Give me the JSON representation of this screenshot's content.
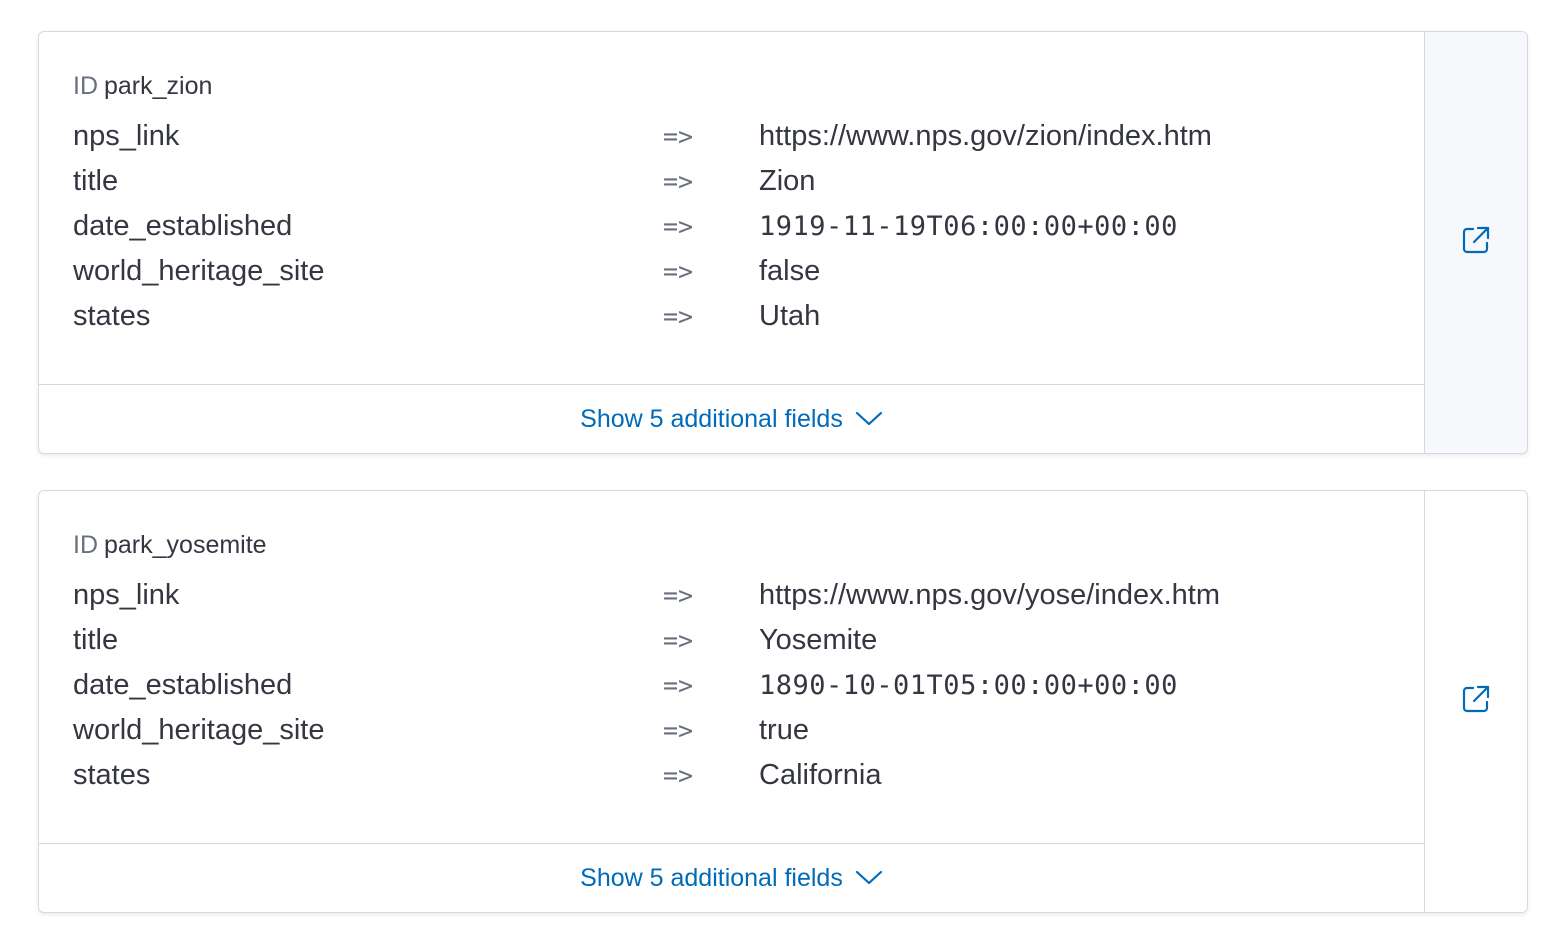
{
  "results": [
    {
      "id_label": "ID",
      "id_value": "park_zion",
      "fields": [
        {
          "key": "nps_link",
          "arrow": "=>",
          "value": "https://www.nps.gov/zion/index.htm"
        },
        {
          "key": "title",
          "arrow": "=>",
          "value": "Zion"
        },
        {
          "key": "date_established",
          "arrow": "=>",
          "value": "1919-11-19T06:00:00+00:00"
        },
        {
          "key": "world_heritage_site",
          "arrow": "=>",
          "value": "false"
        },
        {
          "key": "states",
          "arrow": "=>",
          "value": "Utah"
        }
      ],
      "show_more_label": "Show 5 additional fields",
      "chevron_icon": "chevron-down-icon",
      "link_icon": "external-link-icon"
    },
    {
      "id_label": "ID",
      "id_value": "park_yosemite",
      "fields": [
        {
          "key": "nps_link",
          "arrow": "=>",
          "value": "https://www.nps.gov/yose/index.htm"
        },
        {
          "key": "title",
          "arrow": "=>",
          "value": "Yosemite"
        },
        {
          "key": "date_established",
          "arrow": "=>",
          "value": "1890-10-01T05:00:00+00:00"
        },
        {
          "key": "world_heritage_site",
          "arrow": "=>",
          "value": "true"
        },
        {
          "key": "states",
          "arrow": "=>",
          "value": "California"
        }
      ],
      "show_more_label": "Show 5 additional fields",
      "chevron_icon": "chevron-down-icon",
      "link_icon": "external-link-icon"
    }
  ],
  "colors": {
    "link": "#006bb8",
    "text": "#343741",
    "muted": "#69707d",
    "border": "#d3dae6"
  }
}
